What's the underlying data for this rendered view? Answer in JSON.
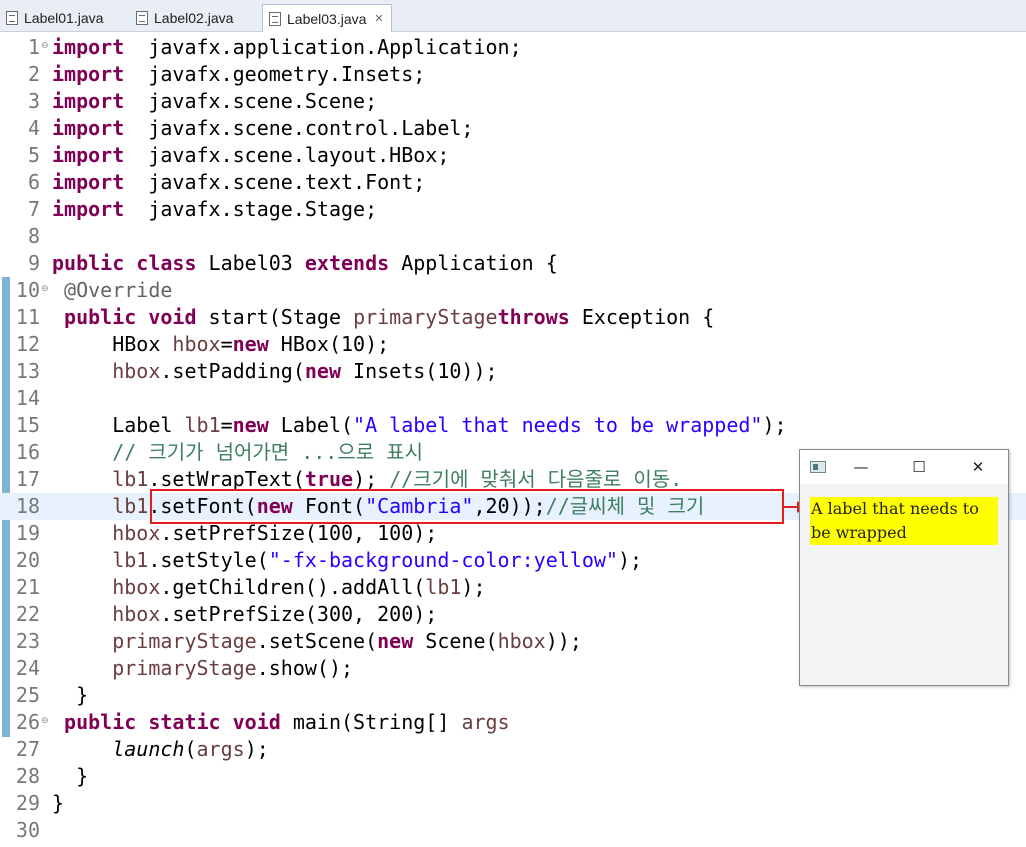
{
  "tabs": [
    {
      "label": "Label01.java",
      "active": false
    },
    {
      "label": "Label02.java",
      "active": false
    },
    {
      "label": "Label03.java",
      "active": true,
      "close": "✕"
    }
  ],
  "editor": {
    "current_line": 18,
    "lines": [
      {
        "num": "1",
        "fold": "⊖",
        "segs": [
          [
            "kw",
            "import"
          ],
          [
            "",
            "  javafx.application.Application;"
          ]
        ]
      },
      {
        "num": "2",
        "segs": [
          [
            "kw",
            "import"
          ],
          [
            "",
            "  javafx.geometry.Insets;"
          ]
        ]
      },
      {
        "num": "3",
        "segs": [
          [
            "kw",
            "import"
          ],
          [
            "",
            "  javafx.scene.Scene;"
          ]
        ]
      },
      {
        "num": "4",
        "segs": [
          [
            "kw",
            "import"
          ],
          [
            "",
            "  javafx.scene.control.Label;"
          ]
        ]
      },
      {
        "num": "5",
        "segs": [
          [
            "kw",
            "import"
          ],
          [
            "",
            "  javafx.scene.layout.HBox;"
          ]
        ]
      },
      {
        "num": "6",
        "segs": [
          [
            "kw",
            "import"
          ],
          [
            "",
            "  javafx.scene.text.Font;"
          ]
        ]
      },
      {
        "num": "7",
        "segs": [
          [
            "kw",
            "import"
          ],
          [
            "",
            "  javafx.stage.Stage;"
          ]
        ]
      },
      {
        "num": "8",
        "segs": []
      },
      {
        "num": "9",
        "segs": [
          [
            "kw",
            "public"
          ],
          [
            "",
            " "
          ],
          [
            "kw",
            "class"
          ],
          [
            "",
            " Label03 "
          ],
          [
            "kw",
            "extends"
          ],
          [
            "",
            " Application {"
          ]
        ]
      },
      {
        "num": "10",
        "fold": "⊖",
        "segs": [
          [
            "",
            " "
          ],
          [
            "ann",
            "@Override"
          ]
        ]
      },
      {
        "num": "11",
        "segs": [
          [
            "",
            " "
          ],
          [
            "kw",
            "public"
          ],
          [
            "",
            " "
          ],
          [
            "kw",
            "void"
          ],
          [
            "",
            " start(Stage "
          ],
          [
            "var",
            "primaryStage"
          ],
          [
            ") "
          ],
          [
            "kw",
            "throws"
          ],
          [
            "",
            " Exception {"
          ]
        ]
      },
      {
        "num": "12",
        "segs": [
          [
            "",
            "     HBox "
          ],
          [
            "var",
            "hbox"
          ],
          [
            "",
            "="
          ],
          [
            "kw",
            "new"
          ],
          [
            "",
            " HBox(10);"
          ]
        ]
      },
      {
        "num": "13",
        "segs": [
          [
            "",
            "     "
          ],
          [
            "var",
            "hbox"
          ],
          [
            "",
            ".setPadding("
          ],
          [
            "kw",
            "new"
          ],
          [
            "",
            " Insets(10));"
          ]
        ]
      },
      {
        "num": "14",
        "segs": []
      },
      {
        "num": "15",
        "segs": [
          [
            "",
            "     Label "
          ],
          [
            "var",
            "lb1"
          ],
          [
            "",
            "="
          ],
          [
            "kw",
            "new"
          ],
          [
            "",
            " Label("
          ],
          [
            "str",
            "\"A label that needs to be wrapped\""
          ],
          [
            "",
            ");"
          ]
        ]
      },
      {
        "num": "16",
        "segs": [
          [
            "",
            "     "
          ],
          [
            "com",
            "// 크기가 넘어가면 ...으로 표시"
          ]
        ]
      },
      {
        "num": "17",
        "segs": [
          [
            "",
            "     "
          ],
          [
            "var",
            "lb1"
          ],
          [
            "",
            ".setWrapText("
          ],
          [
            "kw",
            "true"
          ],
          [
            "",
            "); "
          ],
          [
            "com",
            "//크기에 맞춰서 다음줄로 이동."
          ]
        ]
      },
      {
        "num": "18",
        "segs": [
          [
            "",
            "     "
          ],
          [
            "var",
            "lb1"
          ],
          [
            "",
            ".setFont("
          ],
          [
            "kw",
            "new"
          ],
          [
            "",
            " Font("
          ],
          [
            "str",
            "\"Cambria\""
          ],
          [
            "",
            ",20));"
          ],
          [
            "com",
            "//글씨체 및 크기"
          ]
        ]
      },
      {
        "num": "19",
        "segs": [
          [
            "",
            "     "
          ],
          [
            "var",
            "hbox"
          ],
          [
            "",
            ".setPrefSize(100, 100);"
          ]
        ]
      },
      {
        "num": "20",
        "segs": [
          [
            "",
            "     "
          ],
          [
            "var",
            "lb1"
          ],
          [
            "",
            ".setStyle("
          ],
          [
            "str",
            "\"-fx-background-color:yellow\""
          ],
          [
            "",
            ");"
          ]
        ]
      },
      {
        "num": "21",
        "segs": [
          [
            "",
            "     "
          ],
          [
            "var",
            "hbox"
          ],
          [
            "",
            ".getChildren().addAll("
          ],
          [
            "var",
            "lb1"
          ],
          [
            "",
            ");"
          ]
        ]
      },
      {
        "num": "22",
        "segs": [
          [
            "",
            "     "
          ],
          [
            "var",
            "hbox"
          ],
          [
            "",
            ".setPrefSize(300, 200);"
          ]
        ]
      },
      {
        "num": "23",
        "segs": [
          [
            "",
            "     "
          ],
          [
            "var",
            "primaryStage"
          ],
          [
            "",
            ".setScene("
          ],
          [
            "kw",
            "new"
          ],
          [
            "",
            " Scene("
          ],
          [
            "var",
            "hbox"
          ],
          [
            "",
            "));"
          ]
        ]
      },
      {
        "num": "24",
        "segs": [
          [
            "",
            "     "
          ],
          [
            "var",
            "primaryStage"
          ],
          [
            "",
            ".show();"
          ]
        ]
      },
      {
        "num": "25",
        "segs": [
          [
            "",
            "  }"
          ]
        ]
      },
      {
        "num": "26",
        "fold": "⊖",
        "segs": [
          [
            "",
            " "
          ],
          [
            "kw",
            "public"
          ],
          [
            "",
            " "
          ],
          [
            "kw",
            "static"
          ],
          [
            "",
            " "
          ],
          [
            "kw",
            "void"
          ],
          [
            "",
            " main(String[] "
          ],
          [
            "var",
            "args"
          ],
          [
            ") {"
          ]
        ]
      },
      {
        "num": "27",
        "segs": [
          [
            "",
            "     "
          ],
          [
            "italic",
            "launch"
          ],
          [
            "",
            "("
          ],
          [
            "var",
            "args"
          ],
          [
            "",
            ");"
          ]
        ]
      },
      {
        "num": "28",
        "segs": [
          [
            "",
            "  }"
          ]
        ]
      },
      {
        "num": "29",
        "segs": [
          [
            "",
            "}"
          ]
        ]
      },
      {
        "num": "30",
        "segs": []
      }
    ]
  },
  "preview_window": {
    "minimize": "—",
    "maximize": "☐",
    "close": "✕",
    "label_text": "A label that needs to be wrapped",
    "label_bg": "#ffff00"
  },
  "colors": {
    "keyword": "#7f0055",
    "string": "#2a00ff",
    "comment": "#3f7f5f",
    "variable": "#6a3e3e",
    "annotation": "#646464",
    "highlight_box": "#e02020",
    "current_line": "#e8f2fe"
  },
  "icons": {
    "tab_file": "java-file-icon",
    "window_app": "app-icon"
  }
}
